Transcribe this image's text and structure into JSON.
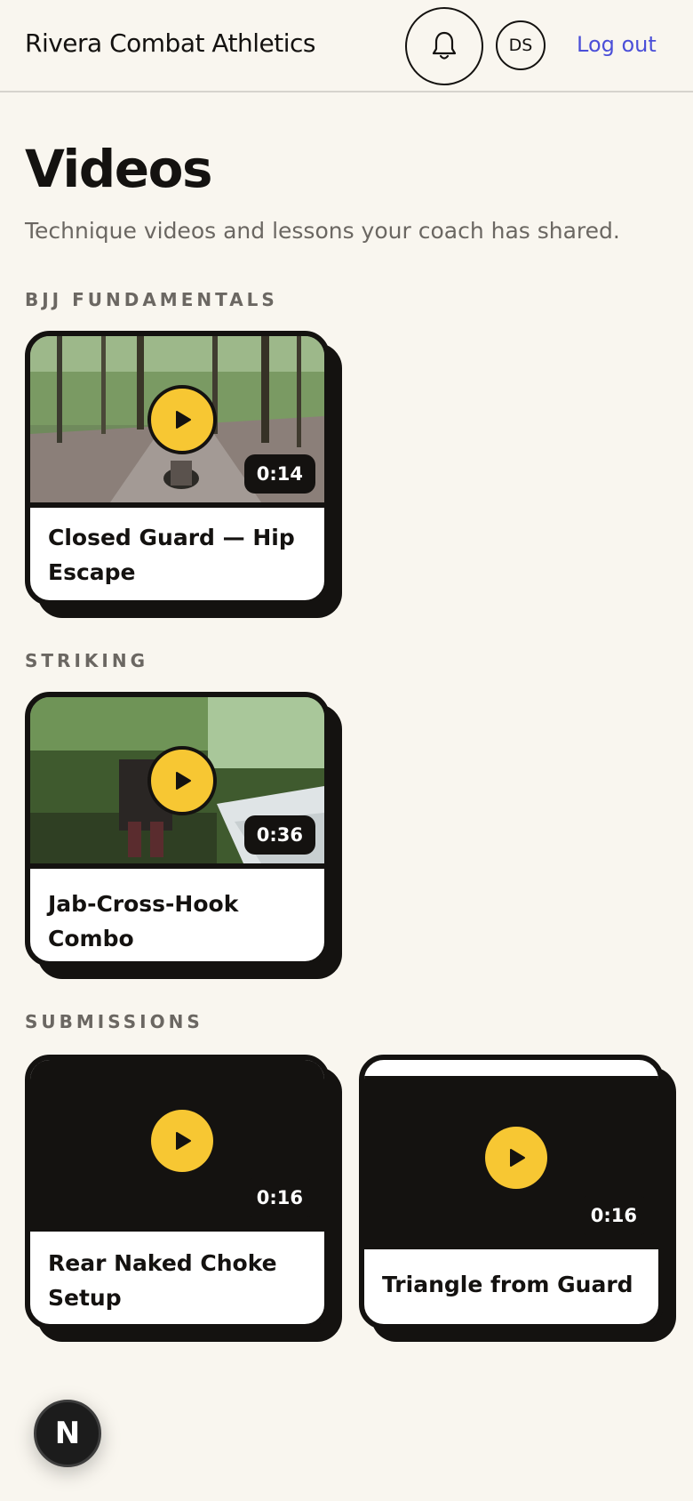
{
  "header": {
    "brand": "Rivera Combat Athletics",
    "avatar_initials": "DS",
    "logout_label": "Log out"
  },
  "page": {
    "title": "Videos",
    "subtitle": "Technique videos and lessons your coach has shared."
  },
  "sections": [
    {
      "label": "BJJ FUNDAMENTALS",
      "videos": [
        {
          "title": "Closed Guard — Hip Escape",
          "duration": "0:14",
          "thumbnail": "forest-path"
        }
      ]
    },
    {
      "label": "STRIKING",
      "videos": [
        {
          "title": "Jab-Cross-Hook Combo",
          "duration": "0:36",
          "thumbnail": "forest-stream"
        }
      ]
    },
    {
      "label": "SUBMISSIONS",
      "videos": [
        {
          "title": "Rear Naked Choke Setup",
          "duration": "0:16",
          "thumbnail": "black"
        },
        {
          "title": "Triangle from Guard",
          "duration": "0:16",
          "thumbnail": "black"
        }
      ]
    }
  ],
  "dev_badge": {
    "label": "N"
  },
  "colors": {
    "background": "#f9f6ef",
    "ink": "#141210",
    "accent_play": "#f7c733",
    "link": "#4b4fd8",
    "muted": "#6b6762"
  }
}
